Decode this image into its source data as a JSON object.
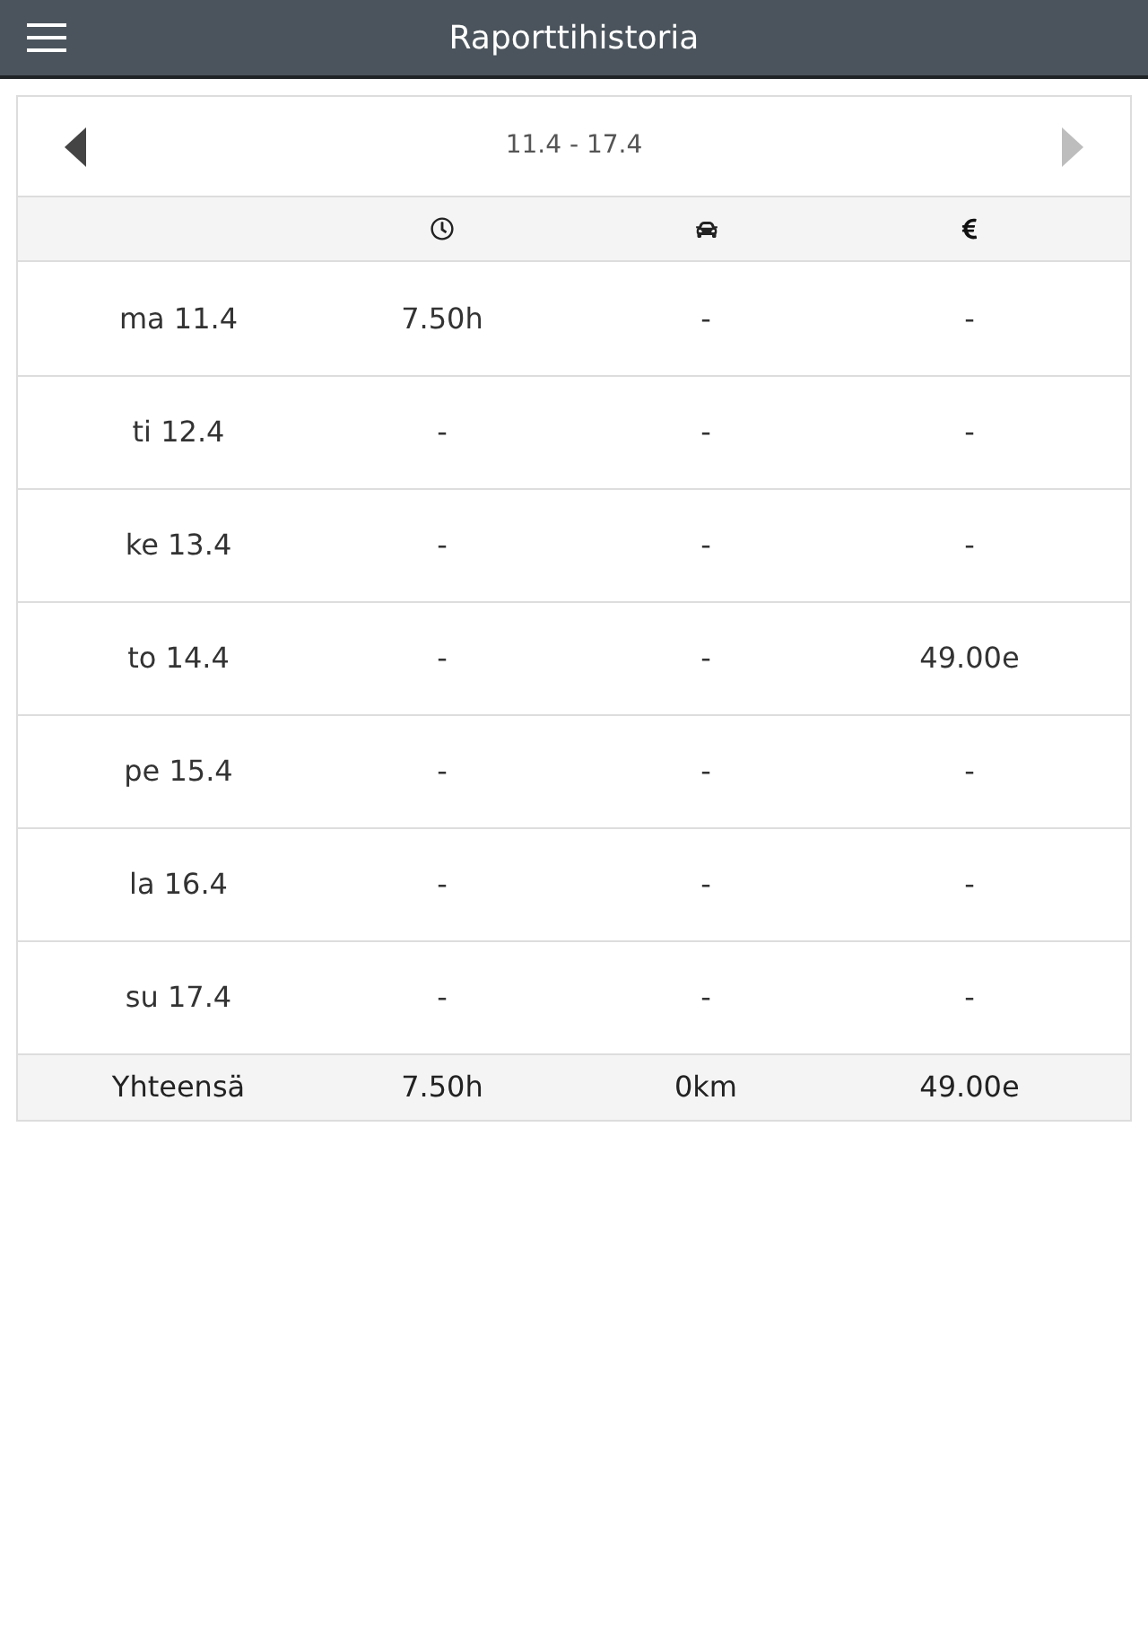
{
  "app_bar": {
    "title": "Raporttihistoria"
  },
  "week_nav": {
    "range": "11.4 - 17.4",
    "prev": {
      "disabled": false
    },
    "next": {
      "disabled": true
    }
  },
  "rows": [
    {
      "cells": [
        "ma 11.4",
        "7.50h",
        "-",
        "-"
      ]
    },
    {
      "cells": [
        "ti 12.4",
        "-",
        "-",
        "-"
      ]
    },
    {
      "cells": [
        "ke 13.4",
        "-",
        "-",
        "-"
      ]
    },
    {
      "cells": [
        "to 14.4",
        "-",
        "-",
        "49.00e"
      ]
    },
    {
      "cells": [
        "pe 15.4",
        "-",
        "-",
        "-"
      ]
    },
    {
      "cells": [
        "la 16.4",
        "-",
        "-",
        "-"
      ]
    },
    {
      "cells": [
        "su 17.4",
        "-",
        "-",
        "-"
      ]
    }
  ],
  "totals": {
    "cells": [
      "Yhteensä",
      "7.50h",
      "0km",
      "49.00e"
    ]
  }
}
